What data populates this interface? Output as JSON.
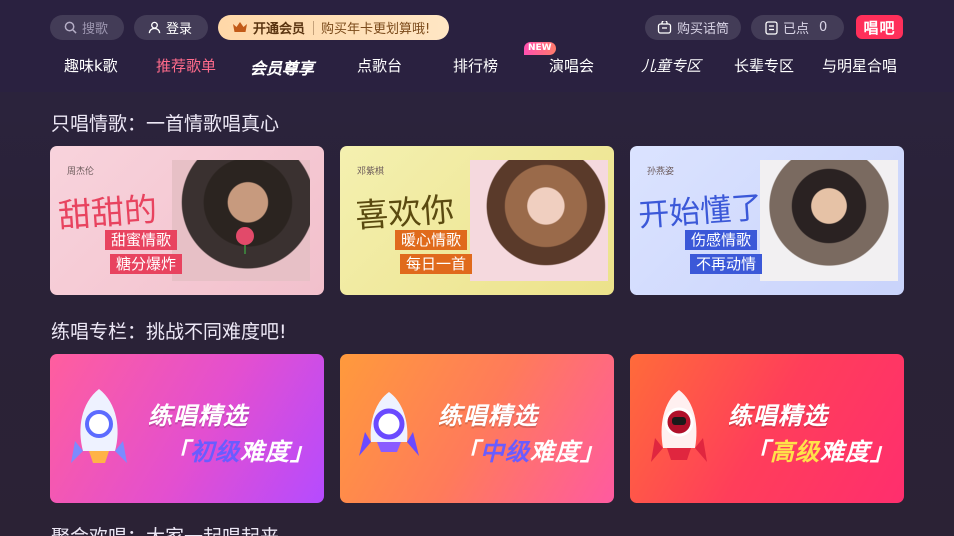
{
  "header": {
    "search_label": "搜歌",
    "login_label": "登录",
    "vip_label": "开通会员",
    "vip_promo": "购买年卡更划算哦!",
    "buy_label": "购买话筒",
    "points_label": "已点",
    "points_count": "0",
    "logo_text": "唱吧"
  },
  "nav": {
    "items": [
      {
        "label": "趣味k歌"
      },
      {
        "label": "推荐歌单"
      },
      {
        "label": "会员尊享"
      },
      {
        "label": "点歌台"
      },
      {
        "label": "排行榜"
      },
      {
        "label": "演唱会"
      },
      {
        "label": "儿童专区"
      },
      {
        "label": "长辈专区"
      },
      {
        "label": "与明星合唱"
      }
    ],
    "active_index": 1,
    "new_badge": "NEW"
  },
  "sections": {
    "love": {
      "title": "只唱情歌：一首情歌唱真心",
      "cards": [
        {
          "singer": "周杰伦",
          "headline": "甜甜的",
          "tag1": "甜蜜情歌",
          "tag2": "糖分爆炸",
          "accent": "#e8435f"
        },
        {
          "singer": "邓紫棋",
          "headline": "喜欢你",
          "tag1": "暖心情歌",
          "tag2": "每日一首",
          "accent": "#e06a1c"
        },
        {
          "singer": "孙燕姿",
          "headline": "开始懂了",
          "tag1": "伤感情歌",
          "tag2": "不再动情",
          "accent": "#3b58d8"
        }
      ]
    },
    "practice": {
      "title": "练唱专栏：挑战不同难度吧!",
      "cards": [
        {
          "title": "练唱精选",
          "level_open": "「",
          "level_key": "初级",
          "level_rest": "难度」"
        },
        {
          "title": "练唱精选",
          "level_open": "「",
          "level_key": "中级",
          "level_rest": "难度」"
        },
        {
          "title": "练唱精选",
          "level_open": "「",
          "level_key": "高级",
          "level_rest": "难度」"
        }
      ]
    },
    "party": {
      "title": "聚会欢唱：大家一起唱起来"
    }
  },
  "colors": {
    "background": "#2b2338",
    "active_nav": "#ff6b8b",
    "logo": "#ff2f5a"
  }
}
